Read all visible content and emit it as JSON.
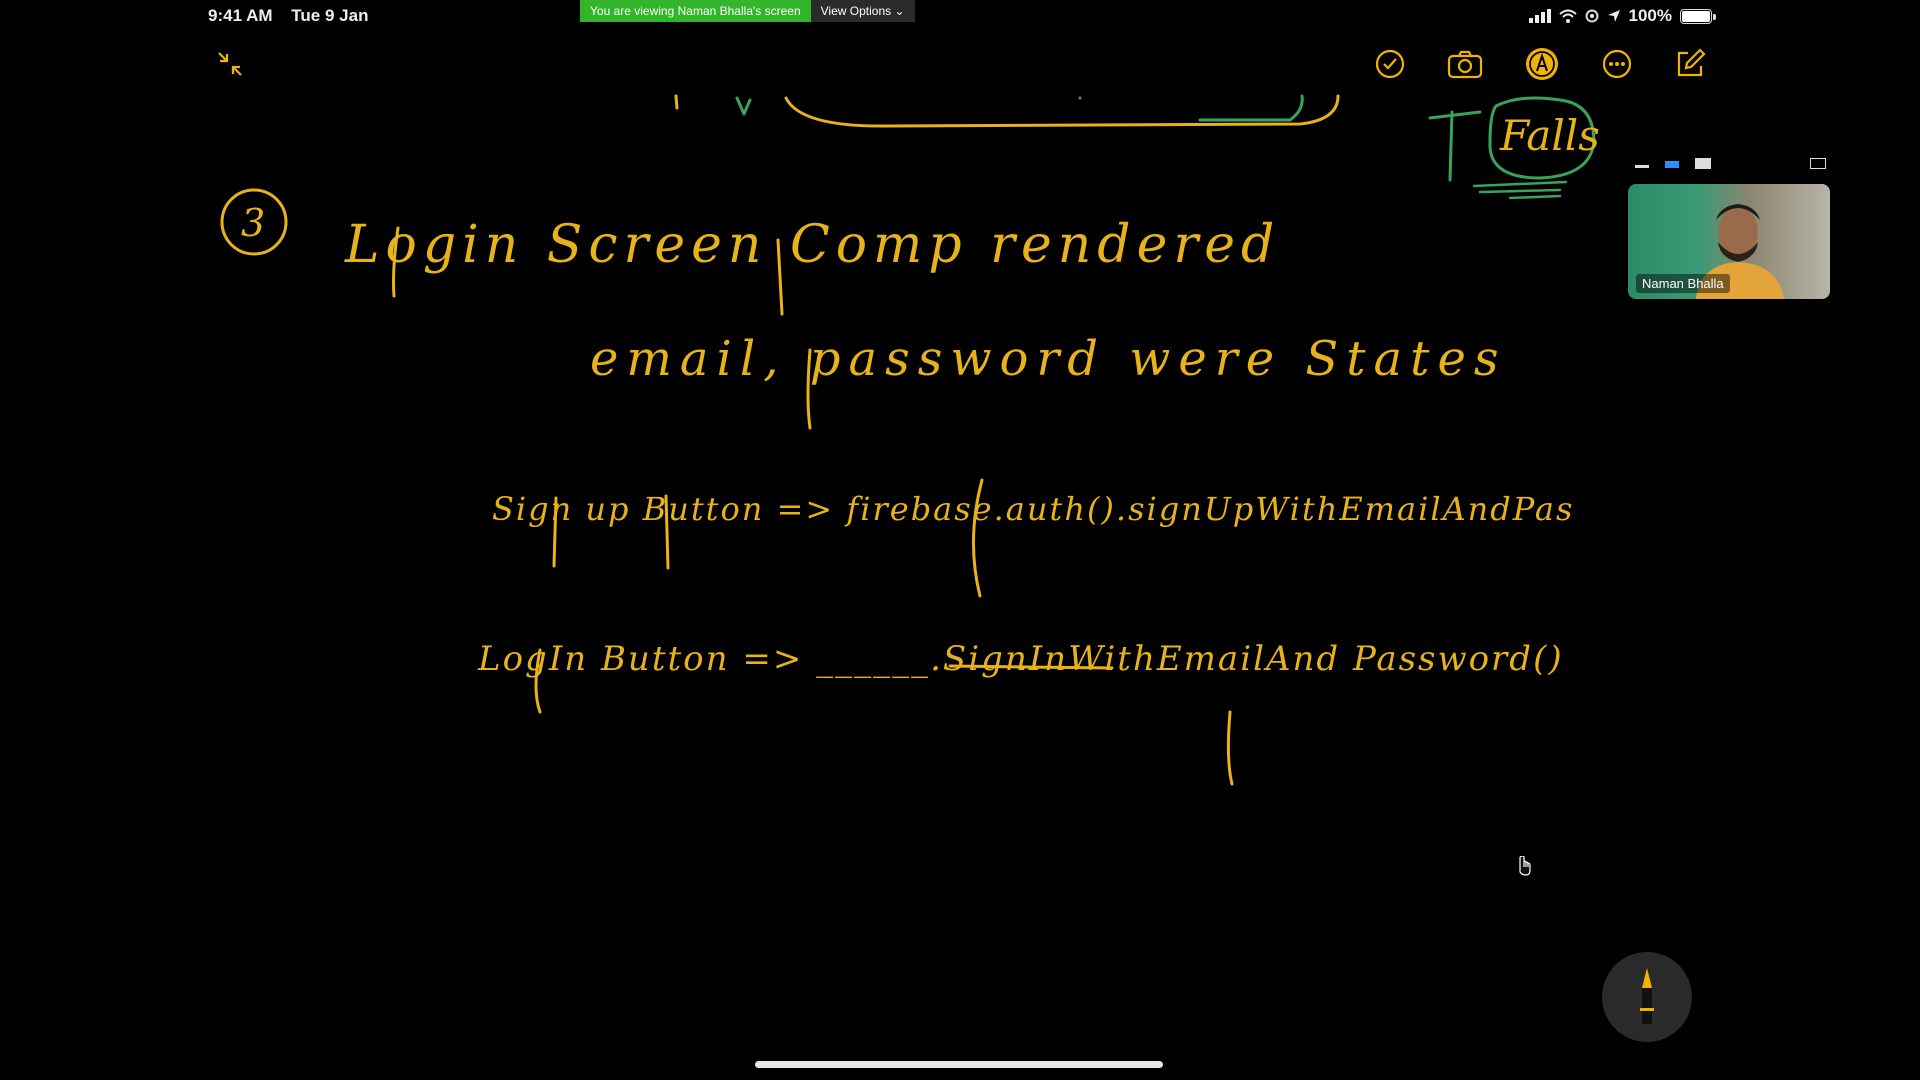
{
  "status_bar": {
    "time": "9:41 AM",
    "date": "Tue 9 Jan",
    "battery": "100%"
  },
  "zoom": {
    "viewing_text": "You are viewing Naman Bhalla's screen",
    "view_options_label": "View Options"
  },
  "toolbar": {
    "icons": [
      "collapse-icon",
      "checkmark-icon",
      "camera-icon",
      "markup-pen-icon",
      "more-icon",
      "compose-icon"
    ],
    "accent": "#f0b400"
  },
  "participant": {
    "name": "Naman Bhalla"
  },
  "ink_color": "#e7b21a",
  "handwriting": {
    "item_number": "3",
    "line1": "Login Screen Comp rendered",
    "line2": "email, password were States",
    "line3": "Sign up Button => firebase.auth().signUpWithEmailAndPas",
    "line4": "LogIn Button => ______.SignInWithEmailAnd Password()",
    "corner_word": "Falls"
  }
}
